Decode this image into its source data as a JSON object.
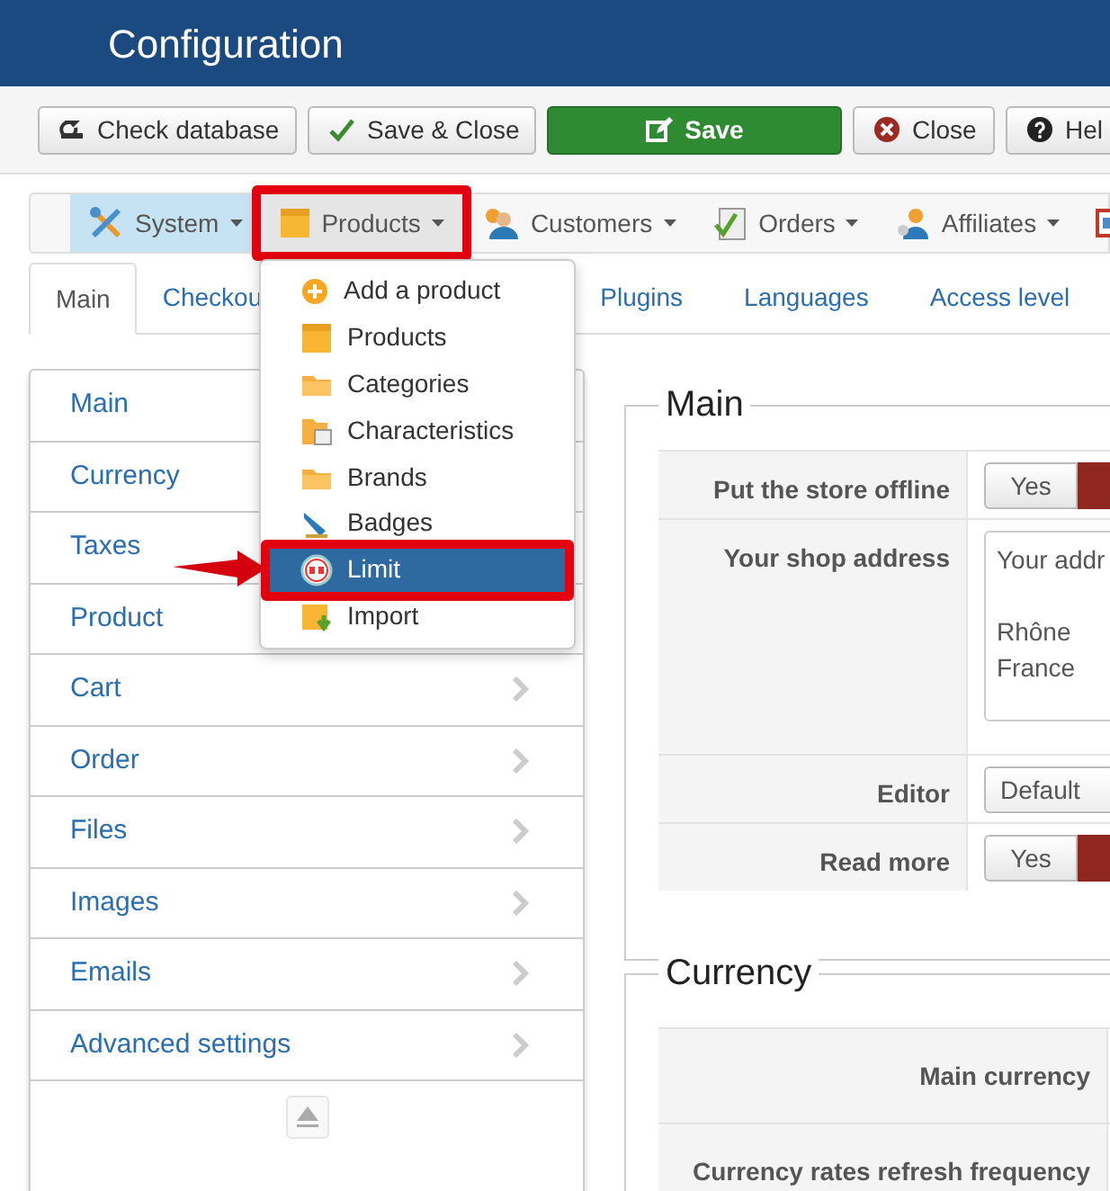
{
  "header": {
    "title": "Configuration"
  },
  "toolbar": [
    {
      "label": "Check database",
      "kind": "check"
    },
    {
      "label": "Save & Close",
      "kind": "save_close"
    },
    {
      "label": "Save",
      "kind": "save"
    },
    {
      "label": "Close",
      "kind": "close"
    },
    {
      "label": "Hel",
      "kind": "help"
    }
  ],
  "menubar": [
    {
      "label": "System",
      "kind": "system",
      "selected": true,
      "open": false,
      "annotated": false
    },
    {
      "label": "Products",
      "kind": "products",
      "selected": false,
      "open": true,
      "annotated": true
    },
    {
      "label": "Customers",
      "kind": "customers",
      "selected": false,
      "open": false,
      "annotated": false
    },
    {
      "label": "Orders",
      "kind": "orders",
      "selected": false,
      "open": false,
      "annotated": false
    },
    {
      "label": "Affiliates",
      "kind": "affiliates",
      "selected": false,
      "open": false,
      "annotated": false
    },
    {
      "kind": "window",
      "selected": false,
      "open": false,
      "annotated": false
    }
  ],
  "products_menu": [
    {
      "label": "Add a product",
      "kind": "add",
      "selected": false,
      "annotated": false,
      "arrow": false
    },
    {
      "label": "Products",
      "kind": "box",
      "selected": false,
      "annotated": false,
      "arrow": false
    },
    {
      "label": "Categories",
      "kind": "folder",
      "selected": false,
      "annotated": false,
      "arrow": false
    },
    {
      "label": "Characteristics",
      "kind": "folder_doc",
      "selected": false,
      "annotated": false,
      "arrow": false
    },
    {
      "label": "Brands",
      "kind": "folder",
      "selected": false,
      "annotated": false,
      "arrow": false
    },
    {
      "label": "Badges",
      "kind": "badge",
      "selected": false,
      "annotated": false,
      "arrow": false
    },
    {
      "label": "Limit",
      "kind": "limit",
      "selected": true,
      "annotated": true,
      "arrow": true
    },
    {
      "label": "Import",
      "kind": "import",
      "selected": false,
      "annotated": false,
      "arrow": false
    }
  ],
  "tabs": [
    {
      "label": "Main",
      "selected": true
    },
    {
      "label": "Checkou",
      "selected": false
    },
    {
      "label": "Plugins",
      "selected": false
    },
    {
      "label": "Languages",
      "selected": false
    },
    {
      "label": "Access level",
      "selected": false
    }
  ],
  "sidebar": {
    "items": [
      {
        "label": "Main",
        "chevron": false
      },
      {
        "label": "Currency",
        "chevron": false
      },
      {
        "label": "Taxes",
        "chevron": false
      },
      {
        "label": "Product",
        "chevron": false
      },
      {
        "label": "Cart",
        "chevron": true
      },
      {
        "label": "Order",
        "chevron": true
      },
      {
        "label": "Files",
        "chevron": true
      },
      {
        "label": "Images",
        "chevron": true
      },
      {
        "label": "Emails",
        "chevron": true
      },
      {
        "label": "Advanced settings",
        "chevron": true
      }
    ]
  },
  "sections": [
    {
      "title": "Main",
      "rows": [
        {
          "label": "Put the store offline",
          "kind": "toggle",
          "options": [
            {
              "label": "Yes",
              "selected": false
            },
            {
              "selected": true
            }
          ]
        },
        {
          "label": "Your shop address",
          "kind": "textarea",
          "value": "Your addr\n\nRhône\nFrance"
        },
        {
          "label": "Editor",
          "kind": "select",
          "value": "Default"
        },
        {
          "label": "Read more",
          "kind": "toggle",
          "options": [
            {
              "label": "Yes",
              "selected": false
            },
            {
              "selected": true
            }
          ]
        }
      ]
    },
    {
      "title": "Currency",
      "rows": [
        {
          "label": "Main currency",
          "kind": "label_only"
        },
        {
          "label": "Currency rates refresh frequency",
          "kind": "label_only"
        }
      ]
    }
  ]
}
